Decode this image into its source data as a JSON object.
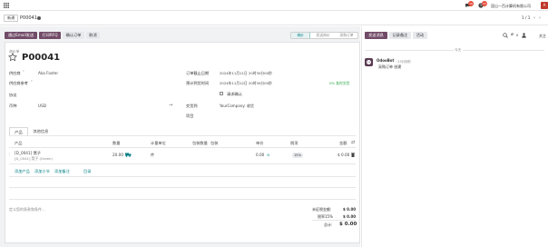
{
  "topnav": {
    "menu_icon": "apps-grid-icon",
    "chat_badge": "10",
    "activity_badge": "24",
    "company": "昆山一百计算机有限公司",
    "avatar_letter": "A"
  },
  "breadcrumb": {
    "new_label": "新建",
    "record": "P00041",
    "pager": "1 / 1"
  },
  "toolbar": {
    "send_by_email": "通过Email发送",
    "print_rfq": "打印RFQ",
    "confirm_order": "确认订单",
    "cancel": "取消"
  },
  "status": {
    "steps": [
      "询价",
      "发送询价",
      "采购订单"
    ],
    "active_index": 0
  },
  "form": {
    "doc_type": "询价单",
    "reference": "P00041",
    "vendor_label": "供应商",
    "vendor_value": "Aka Foster",
    "vendor_ref_label": "供应商参考",
    "agreement_label": "协议",
    "currency_label": "币种",
    "currency_value": "USD",
    "order_deadline_label": "订单截止日期",
    "order_deadline_value": "2024年11月11日 20时30分00秒",
    "expected_arrival_label": "预计到货时间",
    "expected_arrival_value": "2024年11月12日 20时30分00秒",
    "on_time_rate": "0% 准时交货",
    "ask_confirmation_label": "请求确认",
    "deliver_to_label": "交货到",
    "deliver_to_value": "YourCompany: 收货",
    "project_label": "项目"
  },
  "tabs": [
    "产品",
    "其他信息"
  ],
  "table": {
    "headers": [
      "产品",
      "数量",
      "计量单位",
      "包装数量",
      "包装",
      "单价",
      "税项",
      "金额"
    ],
    "rows": [
      {
        "product": "[D_0041] 凳子",
        "variant": "[D_0041] 凳子 (Green)",
        "qty": "20.00",
        "uom": "件",
        "price": "0.00",
        "tax": "15%",
        "amount": "$ 0.00"
      }
    ],
    "add_product": "添加产品",
    "add_section": "添加小节",
    "add_note": "添加备注",
    "catalog": "目录"
  },
  "footer": {
    "terms_placeholder": "定义您的条款和条件...",
    "untaxed_label": "未征税金额:",
    "untaxed_value": "$ 0.00",
    "tax_label": "税率15%",
    "tax_value": "$ 0.00",
    "total_label": "总计:",
    "total_value": "$ 0.00"
  },
  "chatter": {
    "send_message": "发送消息",
    "log_note": "记录备注",
    "activity": "活动",
    "followers_count": "0",
    "follow": "关注",
    "date_separator": "今天",
    "author": "OdooBot",
    "time": "- 23分钟前",
    "message": "采购订单 创建"
  },
  "colors": {
    "brand": "#714b67",
    "accent": "#017e84",
    "badge": "#e74c3c"
  }
}
